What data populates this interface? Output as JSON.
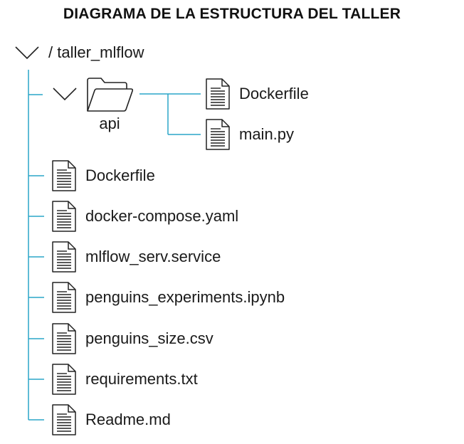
{
  "title": "DIAGRAMA DE LA ESTRUCTURA DEL TALLER",
  "colors": {
    "connector": "#2aa6c8",
    "icon_stroke": "#222222",
    "text": "#1a1a1a"
  },
  "root": {
    "label": "/ taller_mlflow",
    "icon": "chevron-down-icon"
  },
  "api_folder": {
    "label": "api",
    "icon": "folder-open-icon",
    "files": [
      {
        "label": "Dockerfile",
        "icon": "document-icon"
      },
      {
        "label": "main.py",
        "icon": "document-icon"
      }
    ]
  },
  "files": [
    {
      "label": "Dockerfile",
      "icon": "document-icon"
    },
    {
      "label": "docker-compose.yaml",
      "icon": "document-icon"
    },
    {
      "label": "mlflow_serv.service",
      "icon": "document-icon"
    },
    {
      "label": "penguins_experiments.ipynb",
      "icon": "document-icon"
    },
    {
      "label": "penguins_size.csv",
      "icon": "document-icon"
    },
    {
      "label": "requirements.txt",
      "icon": "document-icon"
    },
    {
      "label": "Readme.md",
      "icon": "document-icon"
    }
  ]
}
